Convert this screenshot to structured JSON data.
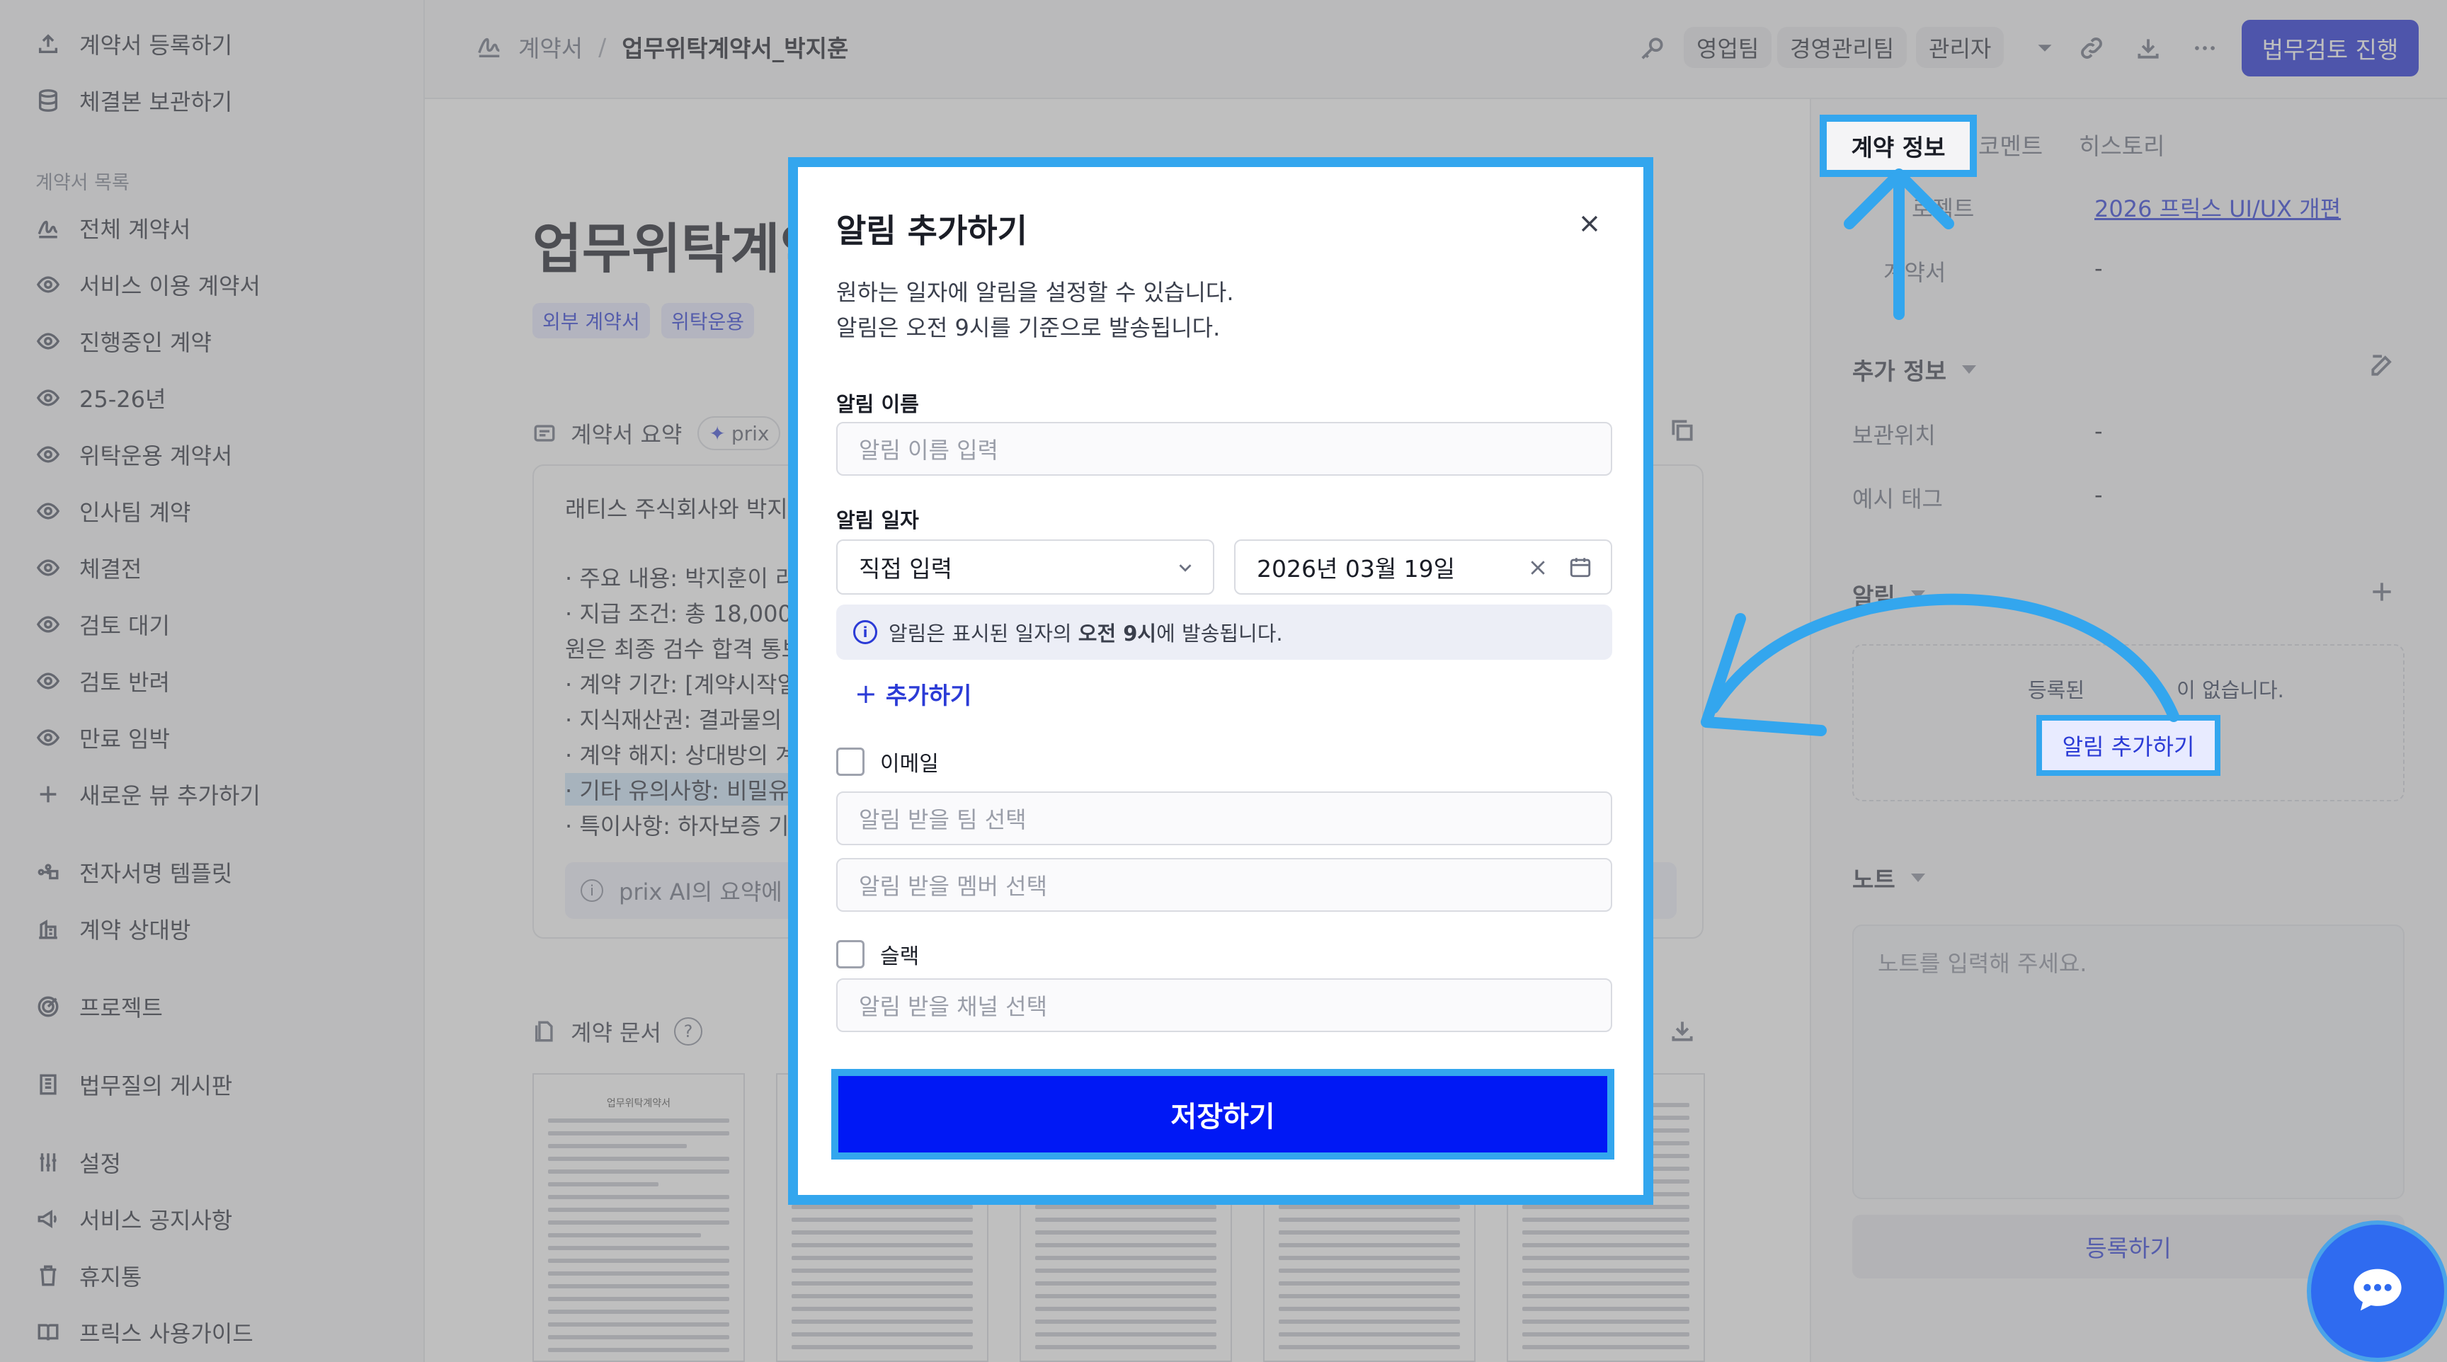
{
  "sidebar": {
    "top_items": [
      {
        "label": "계약서 등록하기",
        "icon": "upload-icon"
      },
      {
        "label": "체결본 보관하기",
        "icon": "database-icon"
      }
    ],
    "section_title": "계약서 목록",
    "list_items": [
      {
        "label": "전체 계약서",
        "icon": "signature-icon"
      },
      {
        "label": "서비스 이용 계약서",
        "icon": "eye-icon"
      },
      {
        "label": "진행중인 계약",
        "icon": "eye-icon"
      },
      {
        "label": "25-26년",
        "icon": "eye-icon"
      },
      {
        "label": "위탁운용 계약서",
        "icon": "eye-icon"
      },
      {
        "label": "인사팀 계약",
        "icon": "eye-icon"
      },
      {
        "label": "체결전",
        "icon": "eye-icon"
      },
      {
        "label": "검토 대기",
        "icon": "eye-icon"
      },
      {
        "label": "검토 반려",
        "icon": "eye-icon"
      },
      {
        "label": "만료 임박",
        "icon": "eye-icon"
      },
      {
        "label": "새로운 뷰 추가하기",
        "icon": "plus-icon"
      }
    ],
    "bottom_items": [
      {
        "label": "전자서명 템플릿",
        "icon": "template-icon"
      },
      {
        "label": "계약 상대방",
        "icon": "building-icon"
      },
      {
        "label": "프로젝트",
        "icon": "target-icon"
      },
      {
        "label": "법무질의 게시판",
        "icon": "board-icon"
      },
      {
        "label": "설정",
        "icon": "sliders-icon"
      },
      {
        "label": "서비스 공지사항",
        "icon": "megaphone-icon"
      },
      {
        "label": "휴지통",
        "icon": "trash-icon"
      },
      {
        "label": "프릭스 사용가이드",
        "icon": "book-icon"
      }
    ]
  },
  "header": {
    "breadcrumb_root": "계약서",
    "breadcrumb_separator": "/",
    "breadcrumb_current": "업무위탁계약서_박지훈",
    "teams": [
      "영업팀",
      "경영관리팀",
      "관리자"
    ],
    "review_button": "법무검토 진행"
  },
  "main": {
    "doc_title": "업무위탁계약",
    "tags": [
      "외부 계약서",
      "위탁운용"
    ],
    "summary_label": "계약서 요약",
    "ai_chip": "prix",
    "summary_lines": [
      "래티스 주식회사와 박지",
      "",
      "· 주요 내용: 박지훈이 라",
      "· 지급 조건: 총 18,000,",
      "원은 최종 검수 합격 통보",
      "· 계약 기간: [계약시작일",
      "· 지식재산권: 결과물의",
      "· 계약 해지: 상대방의 계",
      "· 기타 유의사항: 비밀유",
      "· 특이사항: 하자보증 기"
    ],
    "summary_note": "prix AI의 요약에",
    "documents_label": "계약 문서",
    "thumb_title": "업무위탁계약서"
  },
  "right_panel": {
    "tabs": [
      "계약 정보",
      "코멘트",
      "히스토리"
    ],
    "active_tab": "계약 정보",
    "project_label": "프로젝트",
    "project_label_visible": "로젝트",
    "project_value": "2026 프릭스 UI/UX 개편",
    "contract_label": "계약서",
    "contract_value": "-",
    "extra_info_title": "추가 정보",
    "storage_label": "보관위치",
    "storage_value": "-",
    "example_tag_label": "예시 태그",
    "example_tag_value": "-",
    "alarm_title": "알림",
    "alarm_empty_text_left": "등록된",
    "alarm_empty_text_right": "이 없습니다.",
    "alarm_add_button": "알림 추가하기",
    "note_title": "노트",
    "note_placeholder": "노트를 입력해 주세요.",
    "note_register": "등록하기"
  },
  "modal": {
    "title": "알림 추가하기",
    "desc_line1": "원하는 일자에 알림을 설정할 수 있습니다.",
    "desc_line2": "알림은 오전 9시를 기준으로 발송됩니다.",
    "name_label": "알림 이름",
    "name_placeholder": "알림 이름 입력",
    "date_label": "알림 일자",
    "date_mode": "직접 입력",
    "date_value": "2026년 03월 19일",
    "info_prefix": "알림은 표시된 일자의 ",
    "info_bold": "오전 9시",
    "info_suffix": "에 발송됩니다.",
    "add_more": "추가하기",
    "email_label": "이메일",
    "email_team_placeholder": "알림 받을 팀 선택",
    "email_member_placeholder": "알림 받을 멤버 선택",
    "slack_label": "슬랙",
    "slack_channel_placeholder": "알림 받을 채널 선택",
    "save_button": "저장하기"
  },
  "colors": {
    "accent": "#1d2bd6",
    "save_button": "#0018f5",
    "highlight": "#33a6ee"
  }
}
